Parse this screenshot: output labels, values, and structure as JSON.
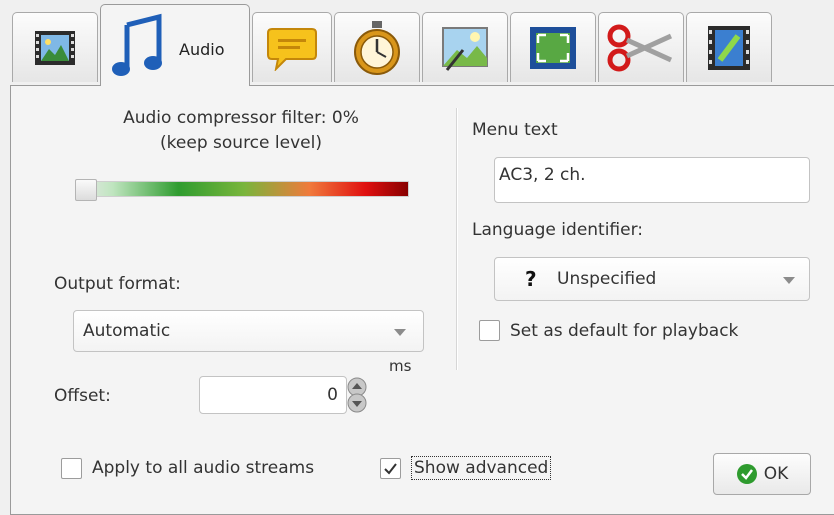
{
  "tabs": [
    {
      "icon": "film-picture-icon"
    },
    {
      "icon": "music-note-icon",
      "label": "Audio"
    },
    {
      "icon": "speech-bubble-icon"
    },
    {
      "icon": "stopwatch-icon"
    },
    {
      "icon": "magic-wand-picture-icon"
    },
    {
      "icon": "crop-frame-icon"
    },
    {
      "icon": "scissors-icon"
    },
    {
      "icon": "film-link-icon"
    }
  ],
  "audio": {
    "compressor_label": "Audio compressor filter: 0%",
    "compressor_note": "(keep source level)",
    "compressor_value": 0,
    "output_format_label": "Output format:",
    "output_format_value": "Automatic",
    "offset_label": "Offset:",
    "offset_unit": "ms",
    "offset_value": "0",
    "apply_all_label": "Apply to all audio streams",
    "apply_all_checked": false,
    "show_advanced_label": "Show advanced",
    "show_advanced_checked": true
  },
  "right": {
    "menu_text_label": "Menu text",
    "menu_text_value": "AC3, 2 ch.",
    "language_label": "Language identifier:",
    "language_value": "Unspecified",
    "language_glyph": "?",
    "default_playback_label": "Set as default for playback",
    "default_playback_checked": false
  },
  "ok_button": {
    "label": "OK"
  },
  "colors": {
    "ok_green": "#2e9b2e",
    "slider_red": "#e01010",
    "slider_green": "#2f9c2f"
  }
}
